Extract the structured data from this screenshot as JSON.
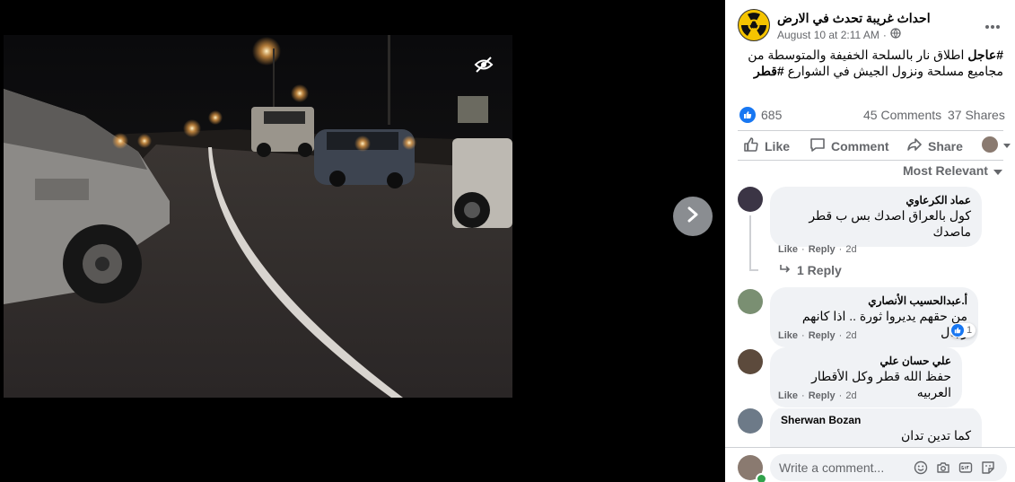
{
  "post": {
    "page_name": "احداث غريبة تحدث في الارض",
    "timestamp": "August 10 at 2:11 AM",
    "privacy_separator": "·",
    "hashtag_urgent": "#عاجل",
    "body_part1": " اطلاق نار بالسلحة الخفيفة والمتوسطة من مجاميع مسلحة ونزول الجيش في الشوارع ",
    "hashtag_qatar": "#قطر",
    "reactions_count": "685",
    "comments_count": "45 Comments",
    "shares_count": "37 Shares"
  },
  "actions": {
    "like": "Like",
    "comment": "Comment",
    "share": "Share"
  },
  "sort_label": "Most Relevant",
  "comments": [
    {
      "name": "عماد الكرعاوي",
      "text_line1": "كول بالعراق اصدك بس ب قطر",
      "text_line2": "ماصدك",
      "like": "Like",
      "reply": "Reply",
      "time": "2d",
      "replies_label": "1 Reply"
    },
    {
      "name": "أ.عبدالحسيب الأنصاري",
      "text": "من حقهم يديروا ثورة .. اذا كانهم رجال",
      "like": "Like",
      "reply": "Reply",
      "time": "2d",
      "reaction_count": "1"
    },
    {
      "name": "علي حسان علي",
      "text": "حفظ الله قطر وكل الأقطار العربيه",
      "like": "Like",
      "reply": "Reply",
      "time": "2d"
    },
    {
      "name": "Sherwan Bozan",
      "text": "كما تدين تدان ."
    }
  ],
  "composer": {
    "placeholder": "Write a comment..."
  },
  "colors": {
    "accent": "#1877f2",
    "muted": "#65676b",
    "bubble": "#f0f2f5",
    "online": "#31a24c"
  },
  "icons": [
    "next-arrow-icon",
    "hide-icon",
    "radiation-icon",
    "globe-icon",
    "more-icon",
    "like-reaction-icon",
    "thumbs-up-icon",
    "comment-icon",
    "share-icon",
    "caret-down-icon",
    "reply-arrow-icon",
    "emoji-icon",
    "camera-icon",
    "gif-icon",
    "sticker-icon"
  ]
}
